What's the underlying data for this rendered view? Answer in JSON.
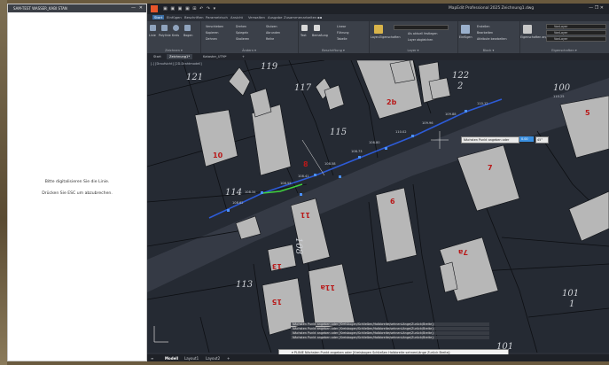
{
  "panel": {
    "title": "SAM-TEST WASSER_KABI STAN",
    "min": "—",
    "close": "✕",
    "line1": "Bitte digitalisieren Sie die Linie.",
    "line2": "Drücken Sie ESC um abzubrechen."
  },
  "app": {
    "title": "MapEdit Professional 2025  Zeichnung1.dwg",
    "qat": "▣ ▣ ▣ ▣ ⊞ ↶ ↷ ▾",
    "win_controls": "—  ❐  ✕"
  },
  "ribbon_tabs": [
    "Start",
    "Einfügen",
    "Beschriften",
    "Parametrisch",
    "Ansicht",
    "Verwalten",
    "Ausgabe",
    "Zusammenarbeiten",
    "▪▪"
  ],
  "ribbon_groups": {
    "draw": {
      "label": "Zeichnen ▾",
      "items": [
        "Linie",
        "Polylinie",
        "Kreis",
        "Bogen"
      ]
    },
    "modify": {
      "label": "Ändern ▾",
      "items": [
        "Verschieben",
        "Kopieren",
        "Dehnen",
        "Drehen",
        "Spiegeln",
        "Skalieren",
        "Stutzen",
        "Abrunden",
        "Reihe"
      ]
    },
    "annotation": {
      "label": "Beschriftung ▾",
      "items": [
        "Text",
        "Bemaßung",
        "Linear",
        "Führung",
        "Tabelle"
      ]
    },
    "layers": {
      "label": "Layer ▾",
      "items": [
        "Layer-Eigenschaften",
        "Als aktuell festlegen",
        "Layer abgleichen"
      ]
    },
    "block": {
      "label": "Block ▾",
      "items": [
        "Einfügen",
        "Erstellen",
        "Bearbeiten",
        "Attribute bearbeiten"
      ]
    },
    "properties": {
      "label": "Eigenschaften ▾",
      "items": [
        "Eigenschaften anpassen",
        "VonLayer",
        "VonLayer",
        "VonLayer"
      ]
    }
  },
  "doc_tabs": [
    "Start",
    "Zeichnung1*",
    "Kataster_UTM*",
    "+"
  ],
  "viewport_label": "[-] [Draufsicht] [2D-Drahtmodell]",
  "parcels": [
    "119",
    "121",
    "117",
    "115",
    "2b",
    "10",
    "8",
    "114",
    "11",
    "108",
    "6",
    "7",
    "7a",
    "13",
    "113",
    "15",
    "11a",
    "122",
    "2",
    "100",
    "5",
    "101",
    "1",
    "101"
  ],
  "coords": [
    "108.62",
    "108.34",
    "108.55",
    "108.41",
    "108.58",
    "108.73",
    "108.80",
    "110.02",
    "109.96",
    "109.88",
    "110.12",
    "110.25"
  ],
  "dynamic_input": {
    "prompt": "Nächsten Punkt angeben oder",
    "value": "0.00",
    "angle": "45°"
  },
  "command_history": [
    "Nächsten Punkt angeben oder [Kreisbogen/Schließen/Halbbreite/sehnenLänge/Zurück/Breite]:",
    "Nächsten Punkt angeben oder [Kreisbogen/Schließen/Halbbreite/sehnenLänge/Zurück/Breite]:",
    "Nächsten Punkt angeben oder [Kreisbogen/Schließen/Halbbreite/sehnenLänge/Zurück/Breite]:",
    "Nächsten Punkt angeben oder [Kreisbogen/Schließen/Halbbreite/sehnenLänge/Zurück/Breite]:"
  ],
  "command_input": "▾ PLINIE Nächsten Punkt angeben oder [Kreisbogen Schließen Halbbreite sehnenLänge Zurück Breite]:",
  "status_tabs": [
    "Modell",
    "Layout1",
    "Layout2",
    "+"
  ],
  "colors": {
    "canvas": "#252a33",
    "building": "#b7b7b7",
    "street": "#3a3f49",
    "polyline": "#2d5bd6",
    "highlight": "#3fd03f",
    "label_red": "#b81919"
  }
}
